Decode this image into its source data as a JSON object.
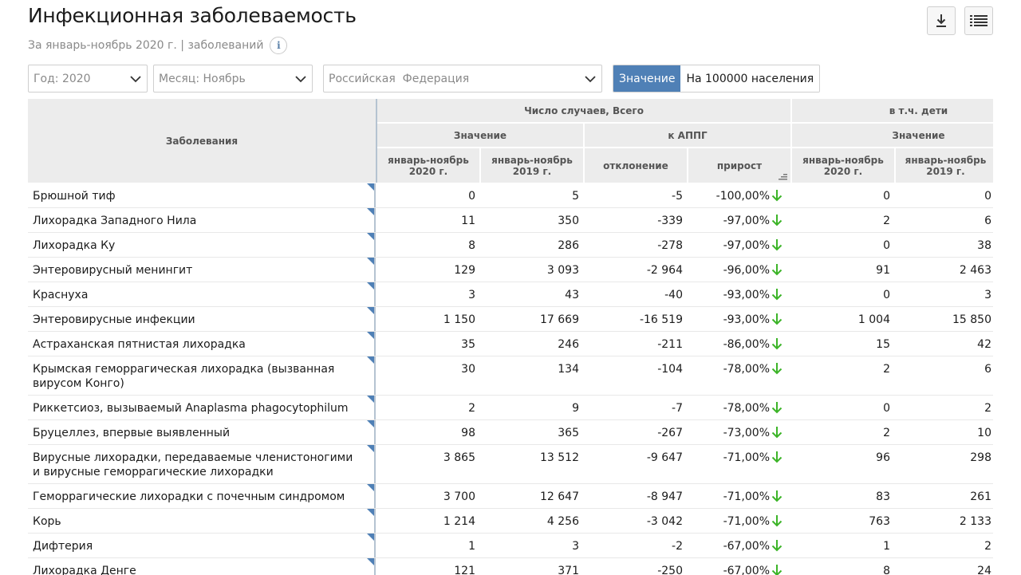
{
  "page": {
    "title": "Инфекционная заболеваемость",
    "subtitle": "За январь-ноябрь 2020 г. | заболеваний",
    "info_icon": "i"
  },
  "toolbar": {
    "download_icon": "download-icon",
    "list_icon": "list-icon"
  },
  "filters": {
    "year": "Год: 2020",
    "month": "Месяц: Ноябрь",
    "region": "Российская  Федерация"
  },
  "toggle": {
    "value_label": "Значение",
    "per100k_label": "На 100000 населения"
  },
  "table": {
    "headers": {
      "diseases": "Заболевания",
      "group_total": "Число случаев, Всего",
      "group_children": "в т.ч. дети",
      "sub_value": "Значение",
      "sub_appg": "к АППГ",
      "sub_value_children": "Значение",
      "col_2020": "январь-ноябрь 2020 г.",
      "col_2019": "январь-ноябрь 2019 г.",
      "col_dev": "отклонение",
      "col_growth": "прирост",
      "col_child_2020": "январь-ноябрь 2020 г.",
      "col_child_2019": "январь-ноябрь 2019 г."
    },
    "rows": [
      {
        "name": "Брюшной тиф",
        "v2020": "0",
        "v2019": "5",
        "dev": "-5",
        "growth": "-100,00%",
        "c2020": "0",
        "c2019": "0"
      },
      {
        "name": "Лихорадка Западного Нила",
        "v2020": "11",
        "v2019": "350",
        "dev": "-339",
        "growth": "-97,00%",
        "c2020": "2",
        "c2019": "6"
      },
      {
        "name": "Лихорадка Ку",
        "v2020": "8",
        "v2019": "286",
        "dev": "-278",
        "growth": "-97,00%",
        "c2020": "0",
        "c2019": "38"
      },
      {
        "name": "Энтеровирусный менингит",
        "v2020": "129",
        "v2019": "3 093",
        "dev": "-2 964",
        "growth": "-96,00%",
        "c2020": "91",
        "c2019": "2 463"
      },
      {
        "name": "Краснуха",
        "v2020": "3",
        "v2019": "43",
        "dev": "-40",
        "growth": "-93,00%",
        "c2020": "0",
        "c2019": "3"
      },
      {
        "name": "Энтеровирусные инфекции",
        "v2020": "1 150",
        "v2019": "17 669",
        "dev": "-16 519",
        "growth": "-93,00%",
        "c2020": "1 004",
        "c2019": "15 850"
      },
      {
        "name": "Астраханская пятнистая лихорадка",
        "v2020": "35",
        "v2019": "246",
        "dev": "-211",
        "growth": "-86,00%",
        "c2020": "15",
        "c2019": "42"
      },
      {
        "name": "Крымская геморрагическая лихорадка (вызванная вирусом Конго)",
        "v2020": "30",
        "v2019": "134",
        "dev": "-104",
        "growth": "-78,00%",
        "c2020": "2",
        "c2019": "6"
      },
      {
        "name": "Риккетсиоз, вызываемый Anaplasma phagocytophilum",
        "v2020": "2",
        "v2019": "9",
        "dev": "-7",
        "growth": "-78,00%",
        "c2020": "0",
        "c2019": "2"
      },
      {
        "name": "Бруцеллез, впервые выявленный",
        "v2020": "98",
        "v2019": "365",
        "dev": "-267",
        "growth": "-73,00%",
        "c2020": "2",
        "c2019": "10"
      },
      {
        "name": "Вирусные лихорадки, передаваемые членистоногими и вирусные геморрагические лихорадки",
        "v2020": "3 865",
        "v2019": "13 512",
        "dev": "-9 647",
        "growth": "-71,00%",
        "c2020": "96",
        "c2019": "298"
      },
      {
        "name": "Геморрагические лихорадки с почечным синдромом",
        "v2020": "3 700",
        "v2019": "12 647",
        "dev": "-8 947",
        "growth": "-71,00%",
        "c2020": "83",
        "c2019": "261"
      },
      {
        "name": "Корь",
        "v2020": "1 214",
        "v2019": "4 256",
        "dev": "-3 042",
        "growth": "-71,00%",
        "c2020": "763",
        "c2019": "2 133"
      },
      {
        "name": "Дифтерия",
        "v2020": "1",
        "v2019": "3",
        "dev": "-2",
        "growth": "-67,00%",
        "c2020": "1",
        "c2019": "2"
      },
      {
        "name": "Лихорадка Денге",
        "v2020": "121",
        "v2019": "371",
        "dev": "-250",
        "growth": "-67,00%",
        "c2020": "8",
        "c2019": "24"
      }
    ]
  },
  "colors": {
    "accent": "#4f80b6",
    "arrow_down": "#3cb428",
    "header_bg": "#ececec"
  }
}
